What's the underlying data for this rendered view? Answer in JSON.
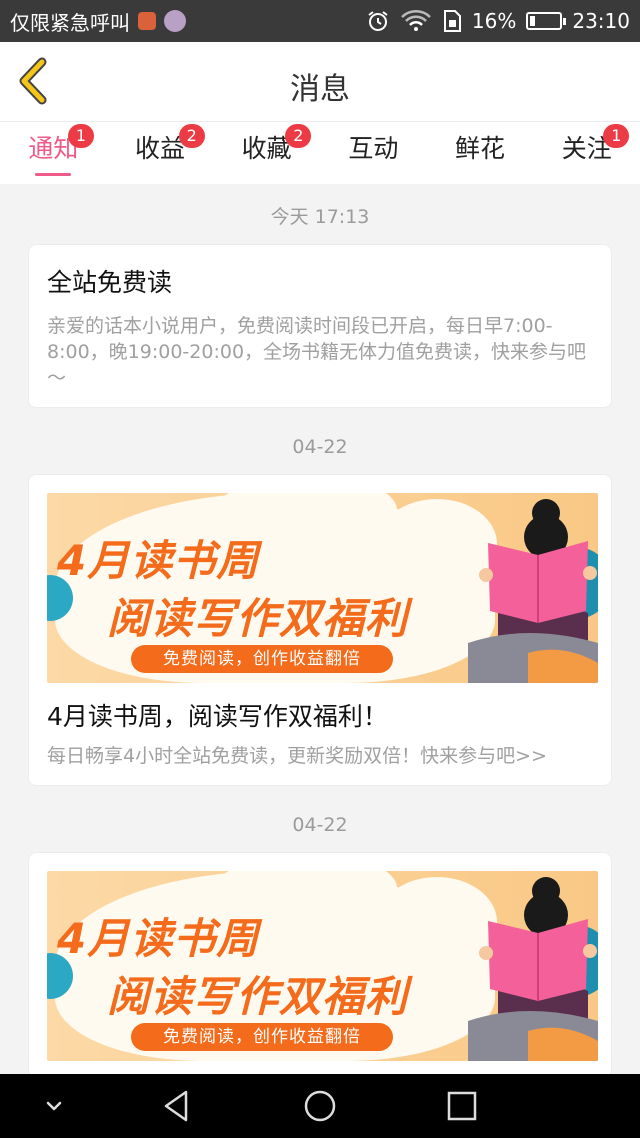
{
  "status_bar": {
    "left_text": "仅限紧急呼叫",
    "battery_percent": "16%",
    "battery_level": 0.16,
    "time": "23:10"
  },
  "header": {
    "title": "消息"
  },
  "tabs": [
    {
      "label": "通知",
      "badge": "1",
      "active": true
    },
    {
      "label": "收益",
      "badge": "2",
      "active": false
    },
    {
      "label": "收藏",
      "badge": "2",
      "active": false
    },
    {
      "label": "互动",
      "badge": "",
      "active": false
    },
    {
      "label": "鲜花",
      "badge": "",
      "active": false
    },
    {
      "label": "关注",
      "badge": "1",
      "active": false
    }
  ],
  "messages": [
    {
      "date": "今天 17:13",
      "title": "全站免费读",
      "body": "亲爱的话本小说用户，免费阅读时间段已开启，每日早7:00-8:00，晚19:00-20:00，全场书籍无体力值免费读，快来参与吧～"
    },
    {
      "date": "04-22",
      "banner": {
        "line1": "4月读书周",
        "line2": "阅读写作双福利",
        "pill": "免费阅读，创作收益翻倍"
      },
      "title": "4月读书周，阅读写作双福利！",
      "body": "每日畅享4小时全站免费读，更新奖励双倍！快来参与吧>>"
    },
    {
      "date": "04-22",
      "banner": {
        "line1": "4月读书周",
        "line2": "阅读写作双福利",
        "pill": "免费阅读，创作收益翻倍"
      }
    }
  ],
  "icons": {
    "back": "chevron-left-icon",
    "alarm": "alarm-icon",
    "wifi": "wifi-icon",
    "sim": "sim-icon",
    "battery": "battery-icon",
    "nav_down": "chevron-down-icon",
    "nav_back": "triangle-back-icon",
    "nav_home": "circle-home-icon",
    "nav_recent": "square-recent-icon"
  },
  "colors": {
    "accent": "#ef5a88",
    "badge": "#ed3b45",
    "back_arrow": "#f5c518",
    "banner_text": "#f36b1b"
  }
}
